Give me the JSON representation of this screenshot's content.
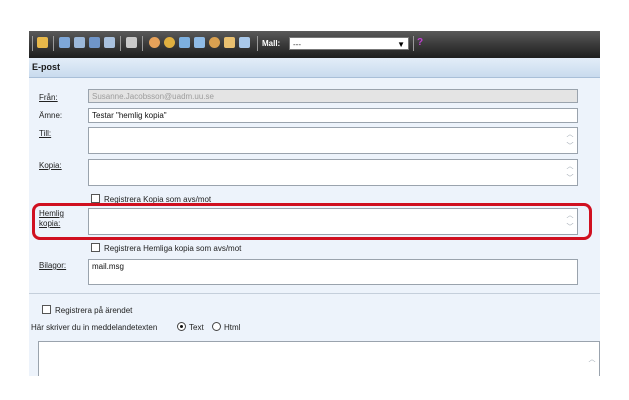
{
  "toolbar": {
    "mall_label": "Mall:",
    "mall_value": "---",
    "help_glyph": "?",
    "icons": [
      "folder-icon",
      "save-icon",
      "print-icon",
      "mail-icon",
      "document-icon",
      "key-icon",
      "person-icon",
      "user-icon",
      "card-icon",
      "card2-icon",
      "people-icon",
      "group-icon",
      "address-book-icon"
    ]
  },
  "section_title": "E-post",
  "form": {
    "from_label": "Från:",
    "from_value": "Susanne.Jacobsson@uadm.uu.se",
    "subject_label": "Ämne:",
    "subject_value": "Testar \"hemlig kopia\"",
    "to_label": "Till:",
    "cc_label": "Kopia:",
    "cc_register_label": "Registrera Kopia som avs/mot",
    "bcc_label_line1": "Hemlig",
    "bcc_label_line2": "kopia:",
    "bcc_register_label": "Registrera Hemliga kopia som avs/mot",
    "attachments_label": "Bilagor:",
    "attachments_value": "mail.msg"
  },
  "message": {
    "register_label": "Registrera på ärendet",
    "write_label": "Här skriver du in meddelandetexten",
    "format_text": "Text",
    "format_html": "Html",
    "format_selected": "Text"
  },
  "colors": {
    "highlight": "#d01020",
    "section_bg": "#c9dbee",
    "body_bg": "#edf3fb"
  }
}
